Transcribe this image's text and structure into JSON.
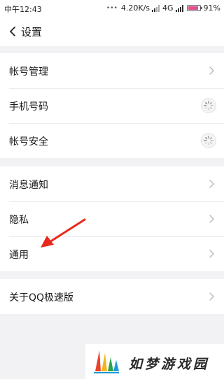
{
  "status_bar": {
    "time": "中午12:43",
    "dots": "•••",
    "speed": "4.20K/s",
    "network": "4G",
    "battery_level": 0.91,
    "battery_text": "91%",
    "battery_color": "#e0508c"
  },
  "header": {
    "back_icon": "chevron-left-icon",
    "title": "设置"
  },
  "groups": [
    {
      "rows": [
        {
          "label": "帐号管理",
          "trailing": "chevron-right-icon"
        },
        {
          "label": "手机号码",
          "trailing": "loading-spinner-icon"
        },
        {
          "label": "帐号安全",
          "trailing": "loading-spinner-icon"
        }
      ]
    },
    {
      "rows": [
        {
          "label": "消息通知",
          "trailing": "chevron-right-icon"
        },
        {
          "label": "隐私",
          "trailing": "chevron-right-icon"
        },
        {
          "label": "通用",
          "trailing": "chevron-right-icon"
        }
      ]
    },
    {
      "rows": [
        {
          "label": "关于QQ极速版",
          "trailing": "chevron-right-icon"
        }
      ]
    }
  ],
  "annotation": {
    "icon": "red-arrow-icon",
    "color": "#e8291c"
  },
  "watermark": {
    "text": "如梦游戏园",
    "logo_colors": [
      "#e8432a",
      "#f5b31c",
      "#2aa34a",
      "#1d9bd6"
    ]
  }
}
